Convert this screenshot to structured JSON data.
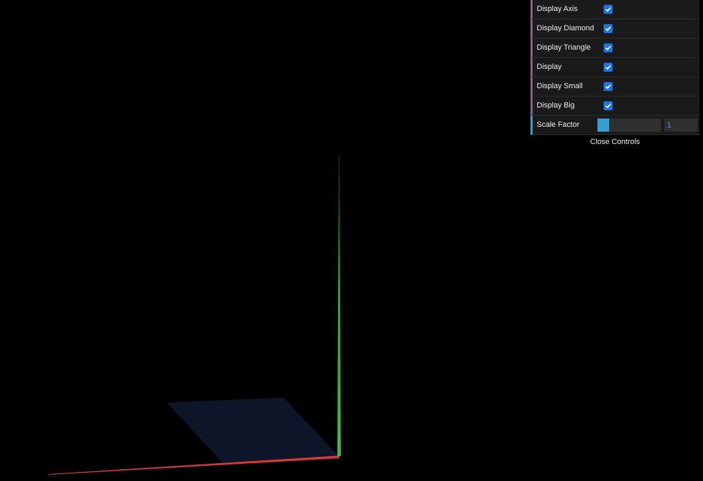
{
  "controls": {
    "display_axis": {
      "label": "Display Axis",
      "checked": true
    },
    "display_diamond": {
      "label": "Display Diamond",
      "checked": true
    },
    "display_triangle": {
      "label": "Display Triangle",
      "checked": true
    },
    "display": {
      "label": "Display",
      "checked": true
    },
    "display_small": {
      "label": "Display Small",
      "checked": true
    },
    "display_big": {
      "label": "Display Big",
      "checked": true
    },
    "scale_factor": {
      "label": "Scale Factor",
      "value": "1",
      "slider_fraction": 0.19
    },
    "close_label": "Close Controls"
  },
  "scene": {
    "background": "#000000",
    "x_axis_color": "#d23a3a",
    "y_axis_color": "#36c23a",
    "plane_color": "#0d1628"
  }
}
